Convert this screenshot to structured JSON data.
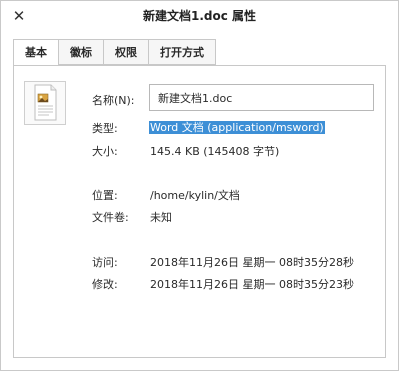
{
  "window": {
    "title": "新建文档1.doc 属性",
    "close_glyph": "✕"
  },
  "tabs": [
    {
      "label": "基本",
      "active": true
    },
    {
      "label": "徽标",
      "active": false
    },
    {
      "label": "权限",
      "active": false
    },
    {
      "label": "打开方式",
      "active": false
    }
  ],
  "file": {
    "icon": "document-icon"
  },
  "fields": {
    "name_label": "名称(N):",
    "name_value": "新建文档1.doc",
    "type_label": "类型:",
    "type_value": "Word 文档 (application/msword)",
    "size_label": "大小:",
    "size_value": "145.4 KB (145408 字节)",
    "location_label": "位置:",
    "location_value": "/home/kylin/文档",
    "volume_label": "文件卷:",
    "volume_value": "未知",
    "accessed_label": "访问:",
    "accessed_value": "2018年11月26日 星期一 08时35分28秒",
    "modified_label": "修改:",
    "modified_value": "2018年11月26日 星期一 08时35分23秒"
  },
  "colors": {
    "selection": "#3d8fd6",
    "border": "#c8c8c8"
  }
}
